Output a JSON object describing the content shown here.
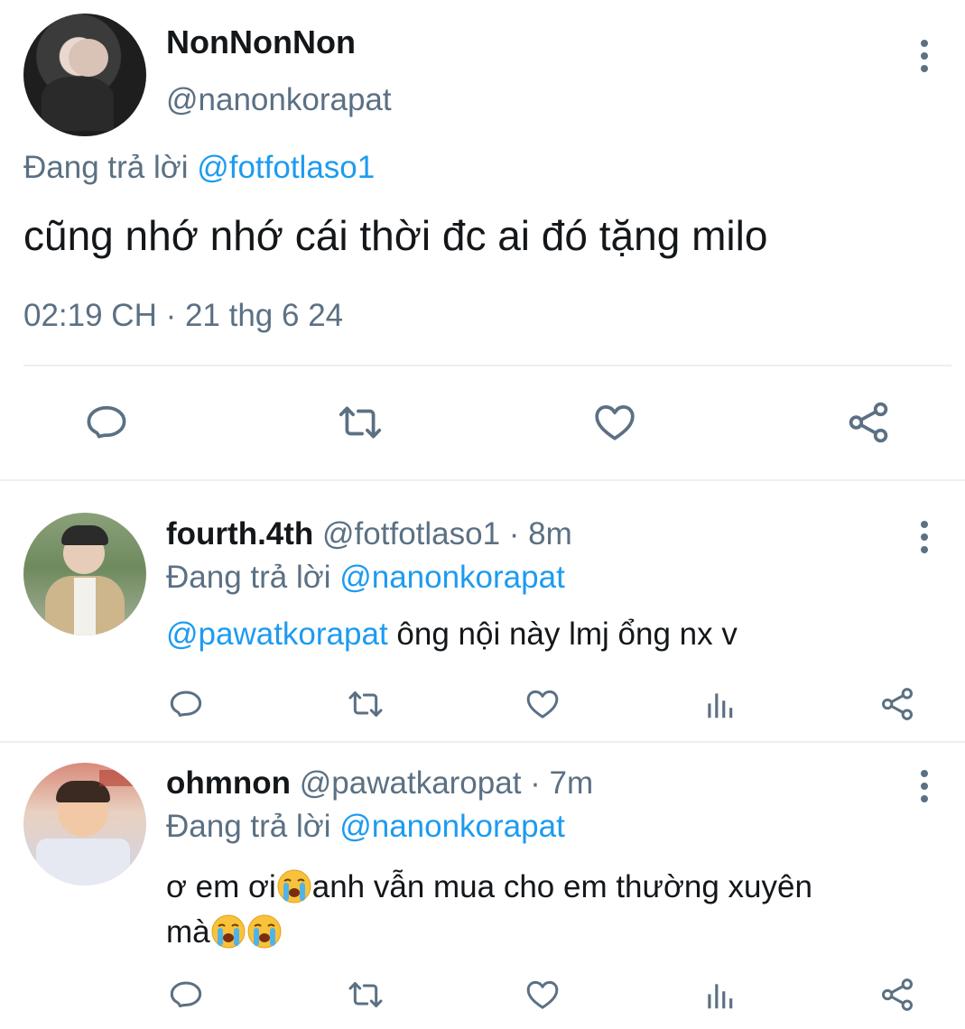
{
  "main_tweet": {
    "display_name": "NonNonNon",
    "handle": "@nanonkorapat",
    "reply_prefix": "Đang trả lời",
    "reply_to": "@fotfotlaso1",
    "text": "cũng nhớ nhớ cái thời đc ai đó tặng milo",
    "timestamp": "02:19 CH · 21 thg 6 24",
    "actions": [
      "reply-icon",
      "retweet-icon",
      "like-icon",
      "share-icon"
    ]
  },
  "replies": [
    {
      "display_name": "fourth.4th",
      "handle": "@fotfotlaso1",
      "time": "· 8m",
      "reply_prefix": "Đang trả lời",
      "reply_to": "@nanonkorapat",
      "mention": "@pawatkorapat",
      "text": " ông nội này lmj ổng nx v",
      "actions": [
        "reply-icon",
        "retweet-icon",
        "like-icon",
        "analytics-icon",
        "share-icon"
      ]
    },
    {
      "display_name": "ohmnon",
      "handle": "@pawatkaropat",
      "time": "· 7m",
      "reply_prefix": "Đang trả lời",
      "reply_to": "@nanonkorapat",
      "text_line1_a": "ơ em ơi",
      "text_line1_b": "anh vẫn mua cho em thường xuyên",
      "text_line2": "mà",
      "emoji": "loudly-crying-face",
      "actions": [
        "reply-icon",
        "retweet-icon",
        "like-icon",
        "analytics-icon",
        "share-icon"
      ]
    }
  ],
  "colors": {
    "link": "#1d9bf0",
    "muted": "#5b7083",
    "icon": "#5b7083",
    "divider": "#eceff1"
  }
}
